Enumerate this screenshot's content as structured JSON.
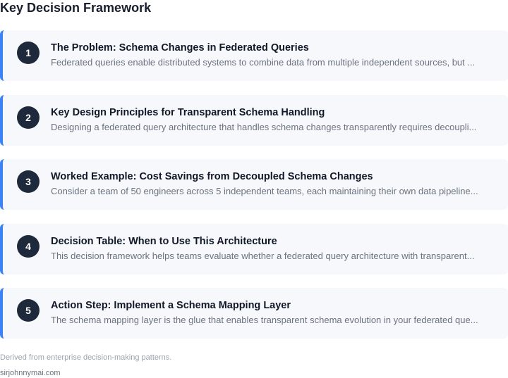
{
  "title": "Key Decision Framework",
  "accent_color": "#3b82f6",
  "badge_color": "#1e293b",
  "card_background": "#f6f8fb",
  "steps": [
    {
      "number": "1",
      "title": "The Problem: Schema Changes in Federated Queries",
      "description": "Federated queries enable distributed systems to combine data from multiple independent sources, but ..."
    },
    {
      "number": "2",
      "title": "Key Design Principles for Transparent Schema Handling",
      "description": "Designing a federated query architecture that handles schema changes transparently requires decoupli..."
    },
    {
      "number": "3",
      "title": "Worked Example: Cost Savings from Decoupled Schema Changes",
      "description": "Consider a team of 50 engineers across 5 independent teams, each maintaining their own data pipeline..."
    },
    {
      "number": "4",
      "title": "Decision Table: When to Use This Architecture",
      "description": "This decision framework helps teams evaluate whether a federated query architecture with transparent..."
    },
    {
      "number": "5",
      "title": "Action Step: Implement a Schema Mapping Layer",
      "description": "The schema mapping layer is the glue that enables transparent schema evolution in your federated que..."
    }
  ],
  "footer": {
    "note": "Derived from enterprise decision-making patterns.",
    "source": "sirjohnnymai.com"
  }
}
